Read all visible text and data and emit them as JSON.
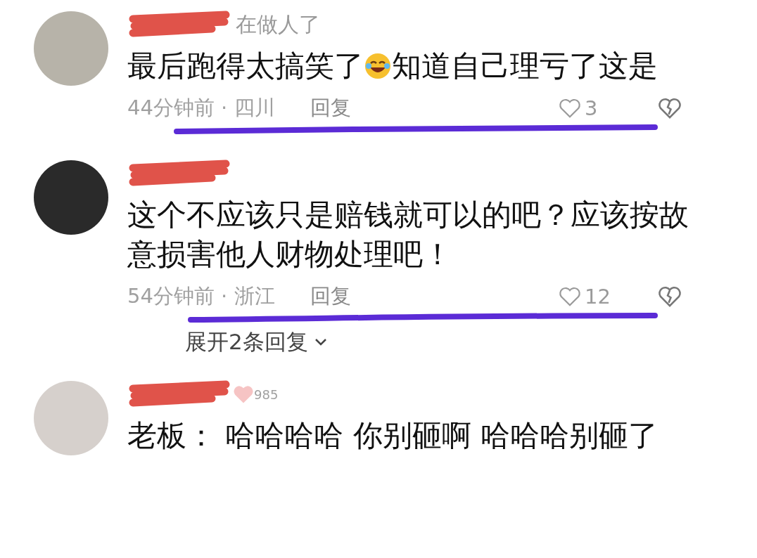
{
  "comments": [
    {
      "name_fragment": "在做人了",
      "body": [
        {
          "kind": "text",
          "text": "最后跑得太搞笑了"
        },
        {
          "kind": "emoji"
        },
        {
          "kind": "text",
          "text": "知道自己理亏了这是"
        }
      ],
      "meta": [
        "44分钟前 · 四川",
        "回复"
      ],
      "likes": "3"
    },
    {
      "body": [
        {
          "kind": "text",
          "text": "这个不应该只是赔钱就可以的吧？应该按故意损害他人财物处理吧！"
        }
      ],
      "meta": [
        "54分钟前 · 浙江",
        "回复"
      ],
      "likes": "12",
      "expand": "展开2条回复"
    },
    {
      "badge": "985",
      "body": [
        {
          "kind": "text",
          "text": "老板：  哈哈哈哈  你别砸啊  哈哈哈别砸了"
        }
      ]
    }
  ]
}
